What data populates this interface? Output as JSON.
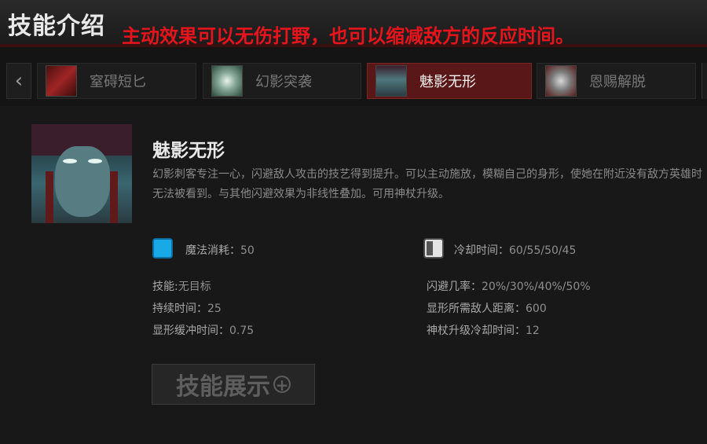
{
  "header": {
    "title": "技能介绍",
    "caption": "主动效果可以无伤打野，也可以缩减敌方的反应时间。"
  },
  "tabs": [
    {
      "label": "窒碍短匕",
      "icon": "dagger-icon",
      "active": false
    },
    {
      "label": "幻影突袭",
      "icon": "phantom-strike-icon",
      "active": false
    },
    {
      "label": "魅影无形",
      "icon": "blur-icon",
      "active": true
    },
    {
      "label": "恩赐解脱",
      "icon": "coup-de-grace-icon",
      "active": false
    }
  ],
  "skill": {
    "name": "魅影无形",
    "description": "幻影刺客专注一心，闪避敌人攻击的技艺得到提升。可以主动施放，模糊自己的身形，使她在附近没有敌方英雄时无法被看到。与其他闪避效果为非线性叠加。可用神杖升级。",
    "mana": {
      "label": "魔法消耗：",
      "value": "50"
    },
    "cooldown": {
      "label": "冷却时间：",
      "value": "60/55/50/45"
    },
    "left_stats": [
      {
        "key": "技能:",
        "value": "无目标"
      },
      {
        "key": "持续时间：",
        "value": "25"
      },
      {
        "key": "显形缓冲时间：",
        "value": "0.75"
      }
    ],
    "right_stats": [
      {
        "key": "闪避几率：",
        "value": "20%/30%/40%/50%"
      },
      {
        "key": "显形所需敌人距离：",
        "value": "600"
      },
      {
        "key": "神杖升级冷却时间：",
        "value": "12"
      }
    ]
  },
  "showcase_button": {
    "label": "技能展示"
  },
  "colors": {
    "accent_red": "#e8141c",
    "active_tab": "#5a1717",
    "mana": "#19a9e6"
  }
}
